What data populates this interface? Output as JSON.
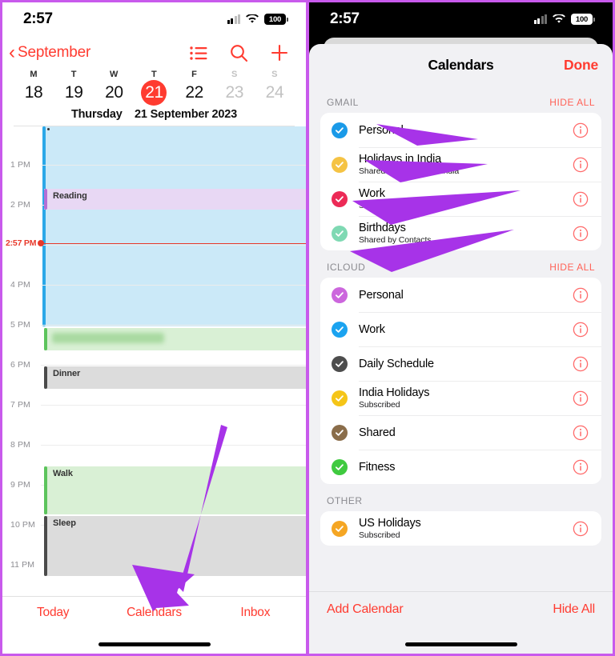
{
  "colors": {
    "ios_red": "#ff3b30",
    "accent_arrow_purple": "#a733e8",
    "now_line_red": "#e8392b",
    "allday_blue": "#cbe9f8"
  },
  "left_panel": {
    "status_bar": {
      "time": "2:57",
      "battery": "100",
      "signal_icon": "signal-bars-icon",
      "wifi_icon": "wifi-icon",
      "battery_icon": "battery-icon"
    },
    "nav": {
      "back_label": "September",
      "back_icon": "chevron-left-icon",
      "icons": [
        {
          "name": "list-view-icon",
          "label": "List"
        },
        {
          "name": "search-icon",
          "label": "Search"
        },
        {
          "name": "add-event-icon",
          "label": "Add"
        }
      ]
    },
    "week": {
      "dow": [
        "M",
        "T",
        "W",
        "T",
        "F",
        "S",
        "S"
      ],
      "days": [
        "18",
        "19",
        "20",
        "21",
        "22",
        "23",
        "24"
      ],
      "today_index": 3,
      "dim_indices": [
        5,
        6
      ],
      "full_date_weekday": "Thursday",
      "full_date_rest": "21 September 2023"
    },
    "timeline": {
      "hours": [
        "1 PM",
        "2 PM",
        "4 PM",
        "5 PM",
        "6 PM",
        "7 PM",
        "8 PM",
        "9 PM",
        "10 PM",
        "11 PM"
      ],
      "now_label": "2:57 PM",
      "events": [
        {
          "title": "Reading",
          "color": "#b36fd6",
          "bg": "#e8d8f4"
        },
        {
          "title": "Dinner",
          "color": "#4a4a4a",
          "bg": "#dcdcdc"
        },
        {
          "title": "Walk",
          "color": "#5cc45c",
          "bg": "#d9f0d5"
        },
        {
          "title": "Sleep",
          "color": "#4a4a4a",
          "bg": "#dcdcdc"
        }
      ]
    },
    "tabbar": [
      {
        "name": "tab-today",
        "label": "Today"
      },
      {
        "name": "tab-calendars",
        "label": "Calendars"
      },
      {
        "name": "tab-inbox",
        "label": "Inbox"
      }
    ]
  },
  "right_panel": {
    "status_bar": {
      "time": "2:57",
      "battery": "100"
    },
    "sheet": {
      "title": "Calendars",
      "done_label": "Done",
      "sections": [
        {
          "title": "GMAIL",
          "hide_all_label": "HIDE ALL",
          "rows": [
            {
              "name": "Personal",
              "sub": "",
              "color": "#1a9ae8",
              "checked": true,
              "obscured": true
            },
            {
              "name": "Holidays in India",
              "sub": "Shared by Holidays in India",
              "color": "#f5c344",
              "checked": true,
              "obscured": true
            },
            {
              "name": "Work",
              "sub": "Shared by Work",
              "color": "#ec2a56",
              "checked": true,
              "obscured": true
            },
            {
              "name": "Birthdays",
              "sub": "Shared by Contacts",
              "color": "#7fd9b3",
              "checked": true,
              "obscured": true
            }
          ]
        },
        {
          "title": "ICLOUD",
          "hide_all_label": "HIDE ALL",
          "rows": [
            {
              "name": "Personal",
              "sub": "",
              "color": "#cc66dd",
              "checked": true,
              "obscured": false
            },
            {
              "name": "Work",
              "sub": "",
              "color": "#1ba3f0",
              "checked": true,
              "obscured": false
            },
            {
              "name": "Daily Schedule",
              "sub": "",
              "color": "#4d4d4d",
              "checked": true,
              "obscured": false
            },
            {
              "name": "India Holidays",
              "sub": "Subscribed",
              "color": "#f5c518",
              "checked": true,
              "obscured": false
            },
            {
              "name": "Shared",
              "sub": "",
              "color": "#8a6d4a",
              "checked": true,
              "obscured": false
            },
            {
              "name": "Fitness",
              "sub": "",
              "color": "#3fca3f",
              "checked": true,
              "obscured": false
            }
          ]
        },
        {
          "title": "OTHER",
          "hide_all_label": "",
          "rows": [
            {
              "name": "US Holidays",
              "sub": "Subscribed",
              "color": "#f5a623",
              "checked": true,
              "obscured": false
            }
          ]
        }
      ],
      "bottom": {
        "add_label": "Add Calendar",
        "hide_label": "Hide All"
      }
    }
  }
}
